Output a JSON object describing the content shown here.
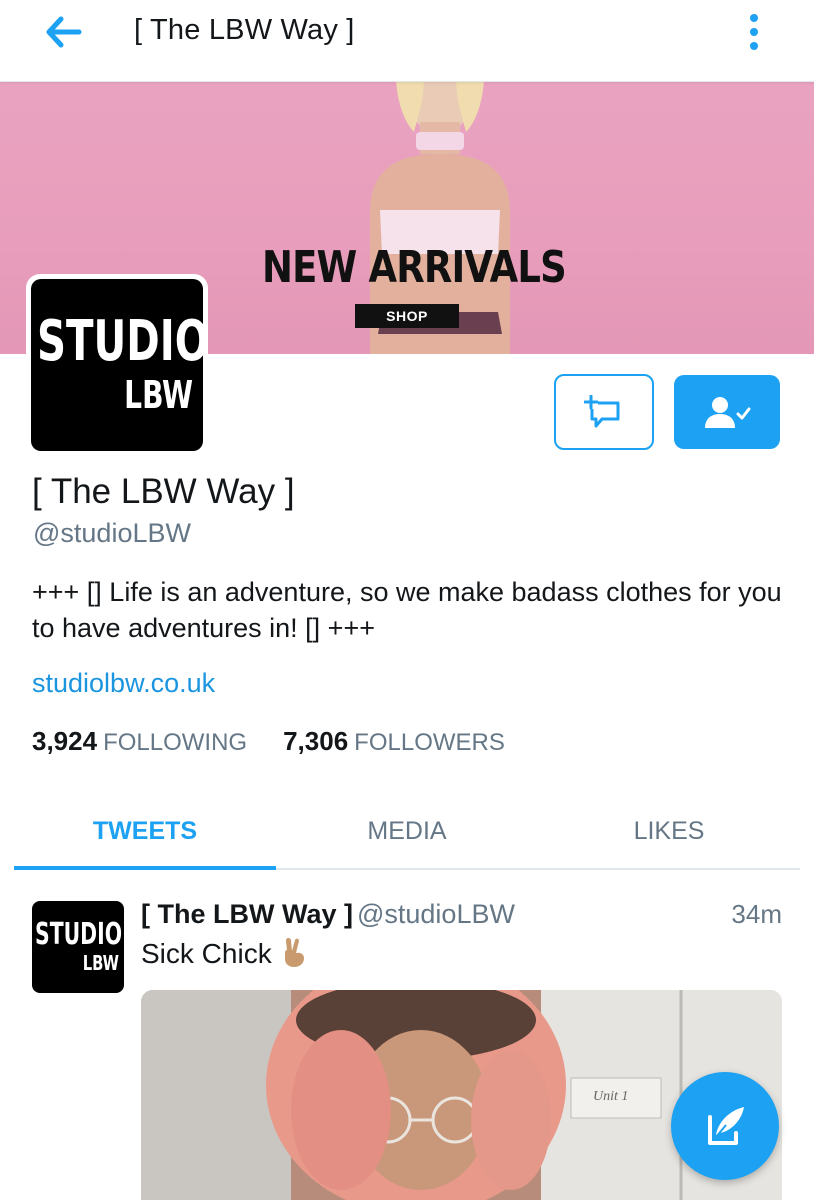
{
  "topbar": {
    "title": "[ The LBW Way ]",
    "back_icon": "arrow-left-icon",
    "menu_icon": "vertical-dots-icon"
  },
  "banner": {
    "headline": "NEW ARRIVALS",
    "cta": "SHOP"
  },
  "avatar": {
    "line1": "STUDIO",
    "line2": "LBW"
  },
  "actions": {
    "message_icon": "direct-message-icon",
    "following_icon": "person-check-icon"
  },
  "profile": {
    "name": "[ The LBW Way ]",
    "handle": "@studioLBW",
    "bio": "+++ [] Life is an adventure, so we make badass clothes for you to have adventures in! [] +++",
    "website": "studiolbw.co.uk",
    "following_count": "3,924",
    "following_label": "FOLLOWING",
    "followers_count": "7,306",
    "followers_label": "FOLLOWERS"
  },
  "tabs": [
    {
      "label": "TWEETS",
      "active": true
    },
    {
      "label": "MEDIA",
      "active": false
    },
    {
      "label": "LIKES",
      "active": false
    }
  ],
  "tweet": {
    "name": "[ The LBW Way ]",
    "handle": "@studioLBW",
    "time": "34m",
    "text": "Sick Chick",
    "emoji_icon": "victory-hand-emoji",
    "media_note_text": "Unit 1"
  },
  "fab": {
    "icon": "compose-quill-icon"
  },
  "colors": {
    "accent": "#1da1f2",
    "link": "#1b95e0",
    "muted": "#657786",
    "banner_pink": "#e9a3c0"
  }
}
